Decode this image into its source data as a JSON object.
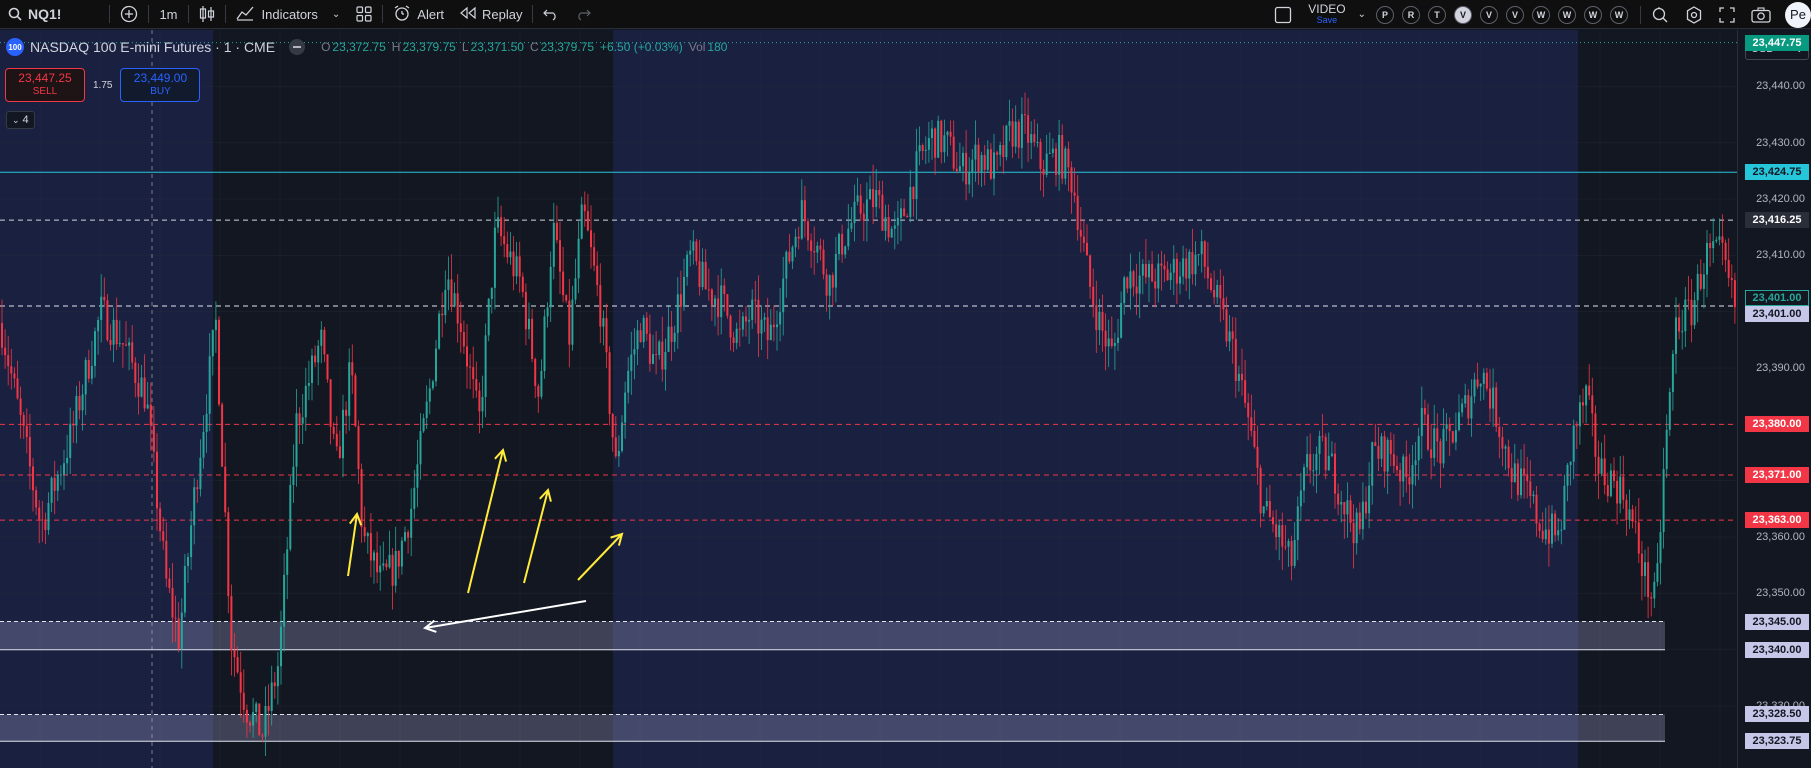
{
  "toolbar": {
    "symbol": "NQ1!",
    "interval": "1m",
    "indicators_label": "Indicators",
    "alert_label": "Alert",
    "replay_label": "Replay",
    "video_label": "VIDEO",
    "video_sub": "Save",
    "layout_circles": [
      "P",
      "R",
      "T",
      "V",
      "V",
      "V",
      "W",
      "W",
      "W",
      "W"
    ],
    "active_circle_index": 3,
    "avatar_letter": "Pe"
  },
  "legend": {
    "logo": "100",
    "title": "NASDAQ 100 E-mini Futures · 1 · CME",
    "o_label": "O",
    "o_val": "23,372.75",
    "h_label": "H",
    "h_val": "23,379.75",
    "l_label": "L",
    "l_val": "23,371.50",
    "c_label": "C",
    "c_val": "23,379.75",
    "change": "+6.50 (+0.03%)",
    "vol_label": "Vol",
    "vol_val": "180"
  },
  "trade": {
    "sell_price": "23,447.25",
    "sell_label": "SELL",
    "spread": "1.75",
    "buy_price": "23,449.00",
    "buy_label": "BUY"
  },
  "collapse_count": "4",
  "currency": "USD",
  "axis": {
    "ticks": [
      "23,440.00",
      "23,430.00",
      "23,420.00",
      "23,410.00",
      "23,390.00",
      "23,360.00",
      "23,350.00",
      "23,330.00"
    ],
    "labels": [
      {
        "text": "23,447.75",
        "kind": "green"
      },
      {
        "text": "23,424.75",
        "kind": "cyan"
      },
      {
        "text": "23,416.25",
        "kind": "dark"
      },
      {
        "text": "23,401.00",
        "kind": "outline"
      },
      {
        "text": "23,401.00",
        "kind": "light"
      },
      {
        "text": "23,380.00",
        "kind": "red"
      },
      {
        "text": "23,371.00",
        "kind": "red"
      },
      {
        "text": "23,363.00",
        "kind": "red"
      },
      {
        "text": "23,345.00",
        "kind": "light"
      },
      {
        "text": "23,340.00",
        "kind": "light"
      },
      {
        "text": "23,328.50",
        "kind": "light"
      },
      {
        "text": "23,323.75",
        "kind": "light"
      }
    ]
  },
  "colors": {
    "up": "#26a69a",
    "down": "#f23645",
    "cyan": "#26c6da",
    "yellow": "#ffeb3b",
    "session_bg": "#1a2040",
    "off_bg": "#131722",
    "zone": "#b2b5e0"
  },
  "chart_data": {
    "type": "candlestick",
    "symbol": "NQ1!",
    "interval": "1m",
    "ylim": [
      23319,
      23450
    ],
    "horizontal_levels": [
      23447.75,
      23424.75,
      23416.25,
      23401.0,
      23380.0,
      23371.0,
      23363.0
    ],
    "zones": [
      [
        23340.0,
        23345.0
      ],
      [
        23323.75,
        23328.5
      ]
    ],
    "path": [
      [
        0,
        23398
      ],
      [
        20,
        23380
      ],
      [
        40,
        23362
      ],
      [
        70,
        23378
      ],
      [
        100,
        23400
      ],
      [
        120,
        23395
      ],
      [
        145,
        23385
      ],
      [
        165,
        23352
      ],
      [
        178,
        23342
      ],
      [
        195,
        23370
      ],
      [
        215,
        23398
      ],
      [
        230,
        23342
      ],
      [
        245,
        23330
      ],
      [
        262,
        23325
      ],
      [
        278,
        23338
      ],
      [
        295,
        23380
      ],
      [
        320,
        23395
      ],
      [
        335,
        23372
      ],
      [
        350,
        23390
      ],
      [
        362,
        23360
      ],
      [
        380,
        23352
      ],
      [
        395,
        23355
      ],
      [
        410,
        23365
      ],
      [
        428,
        23385
      ],
      [
        445,
        23408
      ],
      [
        460,
        23398
      ],
      [
        478,
        23380
      ],
      [
        495,
        23415
      ],
      [
        520,
        23405
      ],
      [
        538,
        23385
      ],
      [
        552,
        23415
      ],
      [
        568,
        23395
      ],
      [
        582,
        23418
      ],
      [
        600,
        23400
      ],
      [
        615,
        23372
      ],
      [
        625,
        23388
      ],
      [
        640,
        23398
      ],
      [
        655,
        23390
      ],
      [
        672,
        23398
      ],
      [
        690,
        23410
      ],
      [
        705,
        23404
      ],
      [
        720,
        23402
      ],
      [
        738,
        23395
      ],
      [
        750,
        23400
      ],
      [
        768,
        23395
      ],
      [
        780,
        23404
      ],
      [
        800,
        23418
      ],
      [
        815,
        23412
      ],
      [
        828,
        23405
      ],
      [
        842,
        23413
      ],
      [
        858,
        23418
      ],
      [
        875,
        23420
      ],
      [
        895,
        23413
      ],
      [
        915,
        23425
      ],
      [
        930,
        23431
      ],
      [
        945,
        23430
      ],
      [
        960,
        23425
      ],
      [
        978,
        23428
      ],
      [
        995,
        23425
      ],
      [
        1010,
        23432
      ],
      [
        1025,
        23432
      ],
      [
        1040,
        23426
      ],
      [
        1058,
        23428
      ],
      [
        1072,
        23423
      ],
      [
        1088,
        23405
      ],
      [
        1100,
        23397
      ],
      [
        1112,
        23392
      ],
      [
        1125,
        23407
      ],
      [
        1140,
        23406
      ],
      [
        1160,
        23406
      ],
      [
        1180,
        23408
      ],
      [
        1200,
        23410
      ],
      [
        1215,
        23402
      ],
      [
        1232,
        23393
      ],
      [
        1248,
        23380
      ],
      [
        1262,
        23365
      ],
      [
        1278,
        23360
      ],
      [
        1290,
        23355
      ],
      [
        1305,
        23372
      ],
      [
        1320,
        23375
      ],
      [
        1332,
        23372
      ],
      [
        1345,
        23365
      ],
      [
        1358,
        23360
      ],
      [
        1372,
        23375
      ],
      [
        1390,
        23375
      ],
      [
        1405,
        23370
      ],
      [
        1420,
        23380
      ],
      [
        1440,
        23375
      ],
      [
        1462,
        23382
      ],
      [
        1480,
        23390
      ],
      [
        1495,
        23382
      ],
      [
        1510,
        23372
      ],
      [
        1525,
        23368
      ],
      [
        1540,
        23362
      ],
      [
        1558,
        23360
      ],
      [
        1572,
        23378
      ],
      [
        1585,
        23385
      ],
      [
        1598,
        23372
      ],
      [
        1612,
        23370
      ],
      [
        1622,
        23368
      ],
      [
        1635,
        23360
      ],
      [
        1645,
        23352
      ],
      [
        1655,
        23348
      ],
      [
        1662,
        23370
      ],
      [
        1675,
        23398
      ],
      [
        1690,
        23400
      ],
      [
        1705,
        23410
      ],
      [
        1720,
        23410
      ],
      [
        1735,
        23400
      ]
    ]
  }
}
